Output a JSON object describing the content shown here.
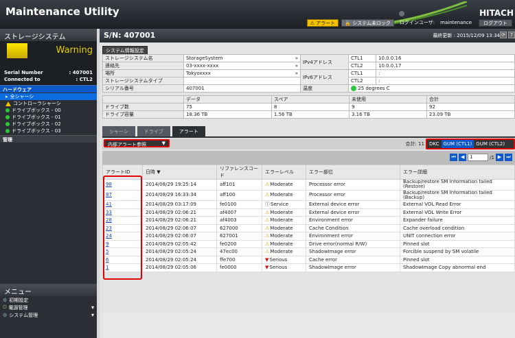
{
  "header": {
    "title": "Maintenance Utility",
    "brand": "HITACH",
    "alert_label": "アラート",
    "lock_label": "システム未ロック",
    "user_label": "ログインユーザ:",
    "user_name": "maintenance",
    "logout_label": "ログアウト"
  },
  "left": {
    "panel_title": "ストレージシステム",
    "status": "Warning",
    "serial_label": "Serial Number",
    "serial_value": ": 407001",
    "connected_label": "Connected to",
    "connected_value": ": CTL2",
    "hardware_label": "ハードウェア",
    "tree": [
      {
        "label": "全シャーシ",
        "icon": "chevron-icon"
      },
      {
        "label": "コントローラシャーシ",
        "icon": "warning-icon"
      },
      {
        "label": "ドライブボックス - 00",
        "icon": "status-ok-icon"
      },
      {
        "label": "ドライブボックス - 01",
        "icon": "status-ok-icon"
      },
      {
        "label": "ドライブボックス - 02",
        "icon": "status-ok-icon"
      },
      {
        "label": "ドライブボックス - 03",
        "icon": "status-ok-icon"
      }
    ],
    "management_label": "管理",
    "menu_title": "メニュー",
    "menu_items": [
      {
        "label": "初期設定"
      },
      {
        "label": "電源管理"
      },
      {
        "label": "システム管理"
      }
    ]
  },
  "main": {
    "serial_title": "S/N: 407001",
    "last_update_label": "最終更新 : 2015/12/09 13:34",
    "refresh_icon": "refresh-icon",
    "help_label": "?",
    "sysinfo_button": "システム情報設定",
    "info": {
      "name_label": "ストレージシステム名",
      "name_value": "StorageSystem",
      "contact_label": "連絡先",
      "contact_value": "03-xxxx-xxxx",
      "location_label": "場所",
      "location_value": "Tokyoxxxx",
      "type_label": "ストレージシステムタイプ",
      "type_value": "",
      "serial_label": "シリアル番号",
      "serial_value": "407001",
      "ipv4_label": "IPv4アドレス",
      "ipv6_label": "IPv6アドレス",
      "ctl1": "CTL1",
      "ctl2": "CTL2",
      "ipv4_ctl1": "10.0.0.16",
      "ipv4_ctl2": "10.0.0.17",
      "ipv6_ctl1": ":",
      "ipv6_ctl2": ":",
      "temp_label": "温度",
      "temp_value": "25 degrees C"
    },
    "capacity": {
      "headers": [
        "データ",
        "スペア",
        "未使用",
        "合計"
      ],
      "drive_count_label": "ドライブ数",
      "drive_capacity_label": "ドライブ容量",
      "counts": [
        "75",
        "8",
        "9",
        "92"
      ],
      "capacities": [
        "18.36 TB",
        "1.56 TB",
        "3.16 TB",
        "23.09 TB"
      ]
    },
    "tabs": [
      {
        "label": "シャーシ"
      },
      {
        "label": "ドライブ"
      },
      {
        "label": "アラート"
      }
    ],
    "filter_label": "内部アラート参照",
    "total_label": "合計: 11",
    "dkc_options": [
      "DKC",
      "GUM (CTL1)",
      "GUM (CTL2)"
    ],
    "pager": {
      "page": "1",
      "of": "/1"
    },
    "columns": [
      "アラートID",
      "日時 ▼",
      "リファレンスコード",
      "エラーレベル",
      "エラー部位",
      "エラー詳細"
    ],
    "rows": [
      {
        "id": "98",
        "time": "2014/08/29 19:25:14",
        "code": "aff101",
        "level": "Moderate",
        "part": "Processor error",
        "detail": "Backup/restore SM Information failed (Restore)"
      },
      {
        "id": "87",
        "time": "2014/08/29 16:33:34",
        "code": "aff100",
        "level": "Moderate",
        "part": "Processor error",
        "detail": "Backup/restore SM Information failed (Backup)"
      },
      {
        "id": "41",
        "time": "2014/08/29 03:17:09",
        "code": "fe0100",
        "level": "Service",
        "part": "External device error",
        "detail": "External VOL Read Error"
      },
      {
        "id": "33",
        "time": "2014/08/29 02:06:21",
        "code": "af4007",
        "level": "Moderate",
        "part": "External device error",
        "detail": "External VOL Write Error"
      },
      {
        "id": "28",
        "time": "2014/08/29 02:06:21",
        "code": "af4003",
        "level": "Moderate",
        "part": "Environment error",
        "detail": "Expander failure"
      },
      {
        "id": "23",
        "time": "2014/08/29 02:06:07",
        "code": "627000",
        "level": "Moderate",
        "part": "Cache Condition",
        "detail": "Cache overload condition"
      },
      {
        "id": "24",
        "time": "2014/08/29 02:06:07",
        "code": "627001",
        "level": "Moderate",
        "part": "Environment error",
        "detail": "UNIT connection error"
      },
      {
        "id": "9",
        "time": "2014/08/29 02:05:42",
        "code": "fe0200",
        "level": "Moderate",
        "part": "Drive error(normal R/W)",
        "detail": "Pinned slot"
      },
      {
        "id": "5",
        "time": "2014/08/29 02:05:24",
        "code": "47ec00",
        "level": "Moderate",
        "part": "ShadowImage error",
        "detail": "Forcible suspend by SM volatile"
      },
      {
        "id": "6",
        "time": "2014/08/29 02:05:24",
        "code": "ffe700",
        "level": "Serious",
        "part": "Cache error",
        "detail": "Pinned slot"
      },
      {
        "id": "1",
        "time": "2014/08/29 02:05:06",
        "code": "fe0000",
        "level": "Serious",
        "part": "ShadowImage error",
        "detail": "ShadowImage Copy abnormal end"
      }
    ]
  }
}
